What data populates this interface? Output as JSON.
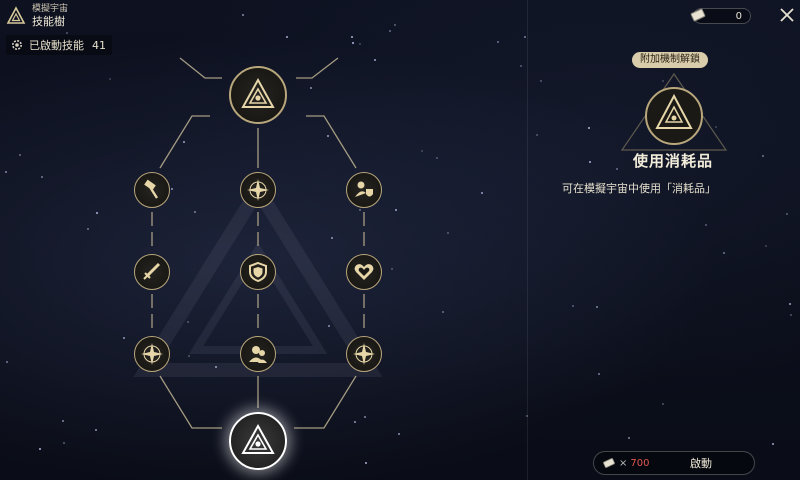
{
  "header": {
    "subtitle": "模擬宇宙",
    "title": "技能樹"
  },
  "activated": {
    "label": "已啟動技能",
    "count": "41"
  },
  "currency": {
    "value": "0"
  },
  "detail": {
    "badge": "附加機制解鎖",
    "title": "使用消耗品",
    "description": "可在模擬宇宙中使用「消耗品」"
  },
  "activate": {
    "multiplier": "×",
    "cost": "700",
    "button_label": "啟動"
  },
  "tree_nodes": [
    {
      "name": "node-root",
      "icon": "trinity-emblem-icon",
      "big": true,
      "selected": false
    },
    {
      "name": "node-left-1",
      "icon": "hammer-icon"
    },
    {
      "name": "node-center-1",
      "icon": "compass-star-icon"
    },
    {
      "name": "node-right-1",
      "icon": "shield-person-icon"
    },
    {
      "name": "node-left-2",
      "icon": "sword-icon"
    },
    {
      "name": "node-center-2",
      "icon": "shield-icon"
    },
    {
      "name": "node-right-2",
      "icon": "heart-icon"
    },
    {
      "name": "node-left-3",
      "icon": "compass-star-icon"
    },
    {
      "name": "node-center-3",
      "icon": "people-icon"
    },
    {
      "name": "node-right-3",
      "icon": "compass-star-icon"
    },
    {
      "name": "node-bottom",
      "icon": "trinity-emblem-icon",
      "big": true,
      "selected": true
    }
  ],
  "colors": {
    "accent_gold": "#b9a77c",
    "cost_red": "#e0574f",
    "badge_bg": "#d9ccaa"
  }
}
